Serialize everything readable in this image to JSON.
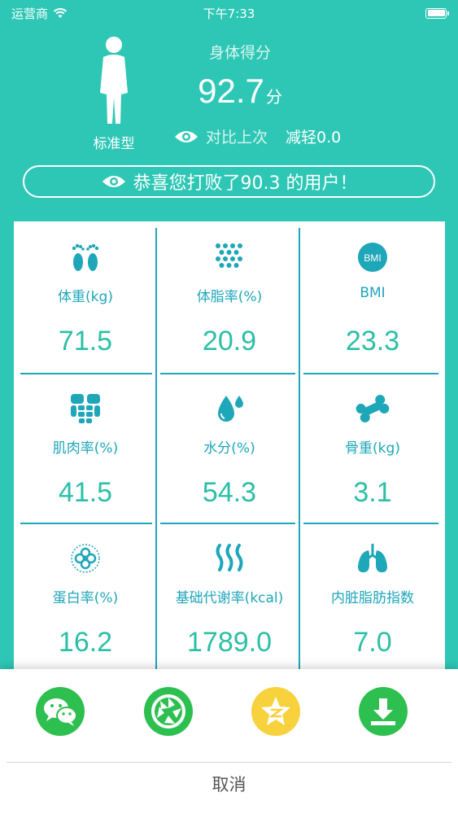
{
  "status_bar": {
    "carrier": "运营商",
    "time": "下午7:33"
  },
  "header": {
    "body_type": "标准型",
    "score_label": "身体得分",
    "score_value": "92.7",
    "score_unit": "分",
    "compare_label": "对比上次",
    "compare_value": "减轻0.0"
  },
  "banner": {
    "text": "恭喜您打败了90.3 的用户！"
  },
  "metrics": [
    {
      "label": "体重(kg)",
      "value": "71.5",
      "icon": "feet-icon"
    },
    {
      "label": "体脂率(%)",
      "value": "20.9",
      "icon": "fat-dots-icon"
    },
    {
      "label": "BMI",
      "value": "23.3",
      "icon": "bmi-icon",
      "icon_text": "BMI"
    },
    {
      "label": "肌肉率(%)",
      "value": "41.5",
      "icon": "muscle-icon"
    },
    {
      "label": "水分(%)",
      "value": "54.3",
      "icon": "water-drop-icon"
    },
    {
      "label": "骨重(kg)",
      "value": "3.1",
      "icon": "bone-icon"
    },
    {
      "label": "蛋白率(%)",
      "value": "16.2",
      "icon": "protein-icon"
    },
    {
      "label": "基础代谢率(kcal)",
      "value": "1789.0",
      "icon": "metabolism-icon"
    },
    {
      "label": "内脏脂肪指数",
      "value": "7.0",
      "icon": "lungs-icon"
    }
  ],
  "share_sheet": {
    "buttons": [
      {
        "name": "wechat",
        "icon": "wechat-icon",
        "color": "#2dbf4f"
      },
      {
        "name": "moments",
        "icon": "moments-icon",
        "color": "#2dbf4f"
      },
      {
        "name": "qzone",
        "icon": "qzone-icon",
        "color": "#f7d23c"
      },
      {
        "name": "download",
        "icon": "download-icon",
        "color": "#2dbf4f"
      }
    ],
    "cancel_label": "取消"
  },
  "colors": {
    "background": "#2ec7b5",
    "metric_text": "#1ea6b9",
    "metric_value": "#2cbfa7",
    "share_green": "#2dbf4f",
    "share_yellow": "#f7d23c"
  }
}
